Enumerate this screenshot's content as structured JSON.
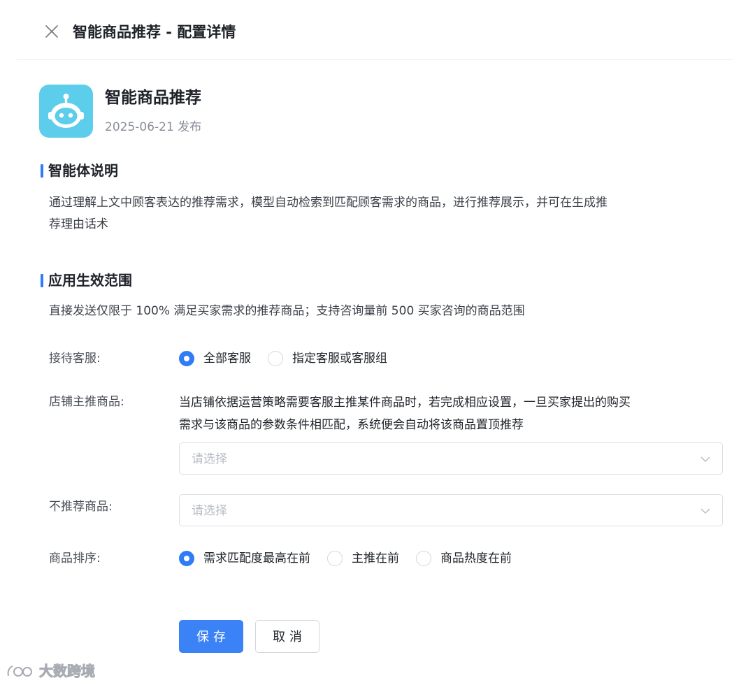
{
  "header": {
    "title": "智能商品推荐 - 配置详情"
  },
  "app": {
    "name": "智能商品推荐",
    "date": "2025-06-21 发布",
    "icon": "robot-icon",
    "icon_bg": "#5ccdea"
  },
  "sections": {
    "intro": {
      "title": "智能体说明",
      "line1": "通过理解上文中顾客表达的推荐需求，模型自动检索到匹配顾客需求的商品，进行推荐展示，并可在生成推",
      "line2": "荐理由话术"
    },
    "scope": {
      "title": "应用生效范围",
      "desc": "直接发送仅限于 100% 满足买家需求的推荐商品；支持咨询量前 500 买家咨询的商品范围"
    }
  },
  "form": {
    "reception": {
      "label": "接待客服:",
      "options": [
        {
          "label": "全部客服",
          "checked": true
        },
        {
          "label": "指定客服或客服组",
          "checked": false
        }
      ]
    },
    "featured": {
      "label": "店铺主推商品:",
      "hint_line1": "当店铺依据运营策略需要客服主推某件商品时，若完成相应设置，一旦买家提出的购买",
      "hint_line2": "需求与该商品的参数条件相匹配，系统便会自动将该商品置顶推荐",
      "placeholder": "请选择"
    },
    "excluded": {
      "label": "不推荐商品:",
      "placeholder": "请选择"
    },
    "sorting": {
      "label": "商品排序:",
      "options": [
        {
          "label": "需求匹配度最高在前",
          "checked": true
        },
        {
          "label": "主推在前",
          "checked": false
        },
        {
          "label": "商品热度在前",
          "checked": false
        }
      ]
    }
  },
  "actions": {
    "save": "保存",
    "cancel": "取消"
  },
  "watermark": {
    "text": "大数跨境"
  },
  "colors": {
    "accent": "#2f7cf6",
    "primary_button": "#3b82f6"
  }
}
